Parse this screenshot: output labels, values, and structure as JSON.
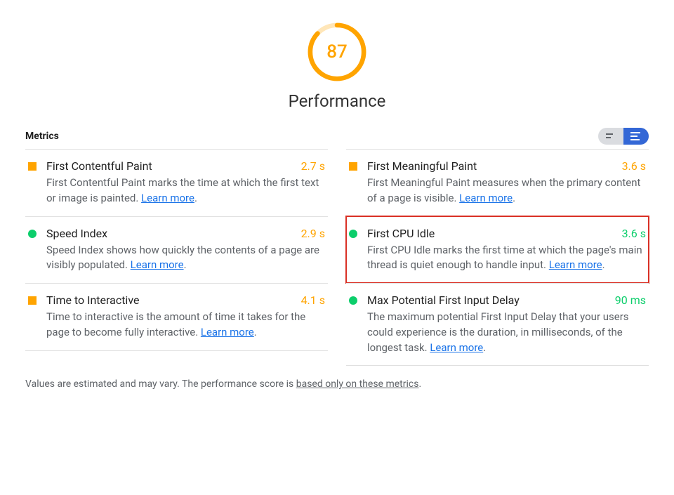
{
  "gauge": {
    "score": "87",
    "title": "Performance",
    "percent": 87,
    "color": "#ffa400"
  },
  "metrics_header": "Metrics",
  "learn_more": "Learn more",
  "left": [
    {
      "status": "orange",
      "title": "First Contentful Paint",
      "value": "2.7 s",
      "color": "orange",
      "desc": "First Contentful Paint marks the time at which the first text or image is painted."
    },
    {
      "status": "green",
      "title": "Speed Index",
      "value": "2.9 s",
      "color": "orange",
      "desc": "Speed Index shows how quickly the contents of a page are visibly populated."
    },
    {
      "status": "orange",
      "title": "Time to Interactive",
      "value": "4.1 s",
      "color": "orange",
      "desc": "Time to interactive is the amount of time it takes for the page to become fully interactive."
    }
  ],
  "right": [
    {
      "status": "orange",
      "title": "First Meaningful Paint",
      "value": "3.6 s",
      "color": "orange",
      "desc": "First Meaningful Paint measures when the primary content of a page is visible.",
      "highlight": false
    },
    {
      "status": "green",
      "title": "First CPU Idle",
      "value": "3.6 s",
      "color": "green",
      "desc": "First CPU Idle marks the first time at which the page's main thread is quiet enough to handle input.",
      "highlight": true
    },
    {
      "status": "green",
      "title": "Max Potential First Input Delay",
      "value": "90 ms",
      "color": "green",
      "desc": "The maximum potential First Input Delay that your users could experience is the duration, in milliseconds, of the longest task.",
      "highlight": false
    }
  ],
  "footer": {
    "pre": "Values are estimated and may vary. The performance score is ",
    "link": "based only on these metrics",
    "post": "."
  }
}
